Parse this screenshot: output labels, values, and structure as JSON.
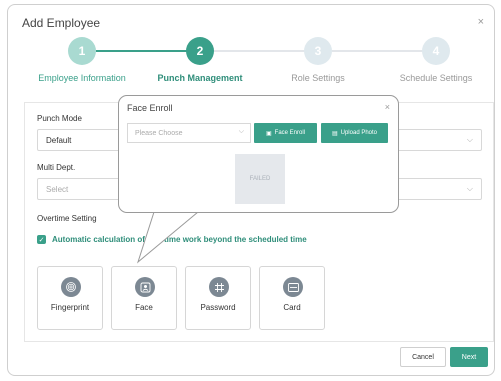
{
  "modal": {
    "title": "Add Employee",
    "close": "×"
  },
  "steps": [
    {
      "number": "1",
      "label": "Employee Information",
      "state": "done"
    },
    {
      "number": "2",
      "label": "Punch Management",
      "state": "active"
    },
    {
      "number": "3",
      "label": "Role Settings",
      "state": "pending"
    },
    {
      "number": "4",
      "label": "Schedule Settings",
      "state": "pending"
    }
  ],
  "form": {
    "punch_mode_label": "Punch Mode",
    "punch_mode_value": "Default",
    "multi_dept_label": "Multi Dept.",
    "multi_dept_placeholder": "Select",
    "overtime_label": "Overtime Setting",
    "overtime_checkbox_label": "Automatic calculation of overtime work beyond the scheduled time",
    "overtime_checked": true
  },
  "punch_methods": [
    {
      "label": "Fingerprint",
      "icon": "fingerprint-icon"
    },
    {
      "label": "Face",
      "icon": "face-icon"
    },
    {
      "label": "Password",
      "icon": "password-icon"
    },
    {
      "label": "Card",
      "icon": "card-icon"
    }
  ],
  "popup": {
    "title": "Face Enroll",
    "close": "×",
    "select_placeholder": "Please Choose",
    "face_enroll_button": "Face Enroll",
    "upload_photo_button": "Upload Photo",
    "status_text": "FAILED"
  },
  "footer": {
    "cancel": "Cancel",
    "next": "Next"
  },
  "colors": {
    "accent": "#3aa08a",
    "pending_step": "#dfe9ee",
    "icon_grey": "#7c8893"
  }
}
